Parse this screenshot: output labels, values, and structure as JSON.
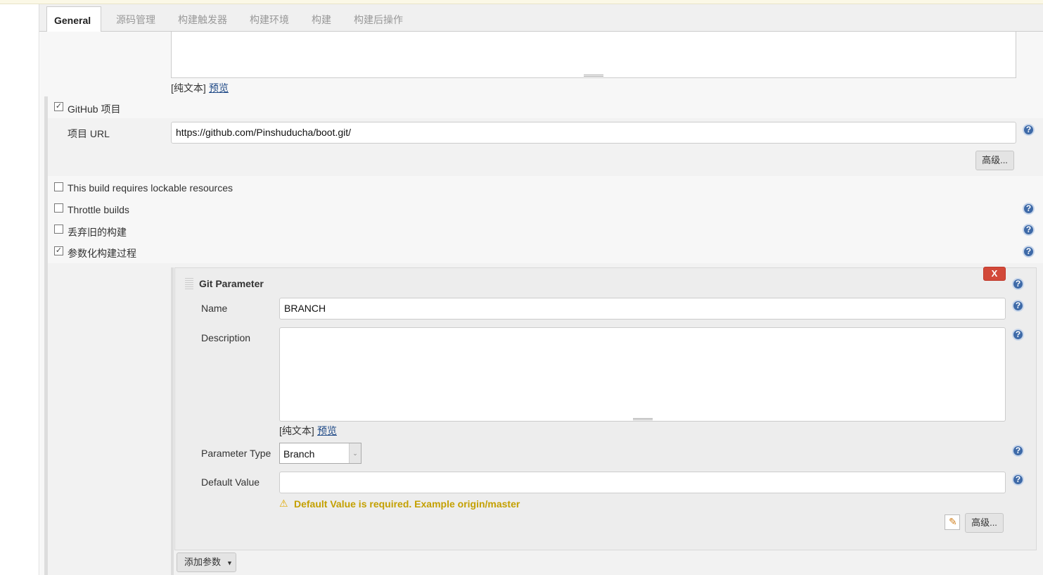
{
  "tabs": [
    {
      "label": "General",
      "active": true
    },
    {
      "label": "源码管理"
    },
    {
      "label": "构建触发器"
    },
    {
      "label": "构建环境"
    },
    {
      "label": "构建"
    },
    {
      "label": "构建后操作"
    }
  ],
  "description": {
    "plain_text": "[纯文本]",
    "preview": "预览"
  },
  "github": {
    "label": "GitHub 项目",
    "checked": true,
    "url_label": "项目 URL",
    "url_value": "https://github.com/Pinshuducha/boot.git/",
    "advanced": "高级..."
  },
  "options": [
    {
      "label": "This build requires lockable resources",
      "checked": false,
      "help": false
    },
    {
      "label": "Throttle builds",
      "checked": false,
      "help": true
    },
    {
      "label": "丢弃旧的构建",
      "checked": false,
      "help": true
    },
    {
      "label": "参数化构建过程",
      "checked": true,
      "help": true
    }
  ],
  "git_param": {
    "title": "Git Parameter",
    "delete": "X",
    "name_label": "Name",
    "name_value": "BRANCH",
    "desc_label": "Description",
    "desc_value": "",
    "plain_text": "[纯文本]",
    "preview": "预览",
    "type_label": "Parameter Type",
    "type_value": "Branch",
    "default_label": "Default Value",
    "default_value": "",
    "warning": "Default Value is required. Example origin/master",
    "advanced": "高级..."
  },
  "add_param": "添加参数",
  "colors": {
    "warning": "#c4a000",
    "delete": "#d24939",
    "help": "#3e6aa8"
  }
}
